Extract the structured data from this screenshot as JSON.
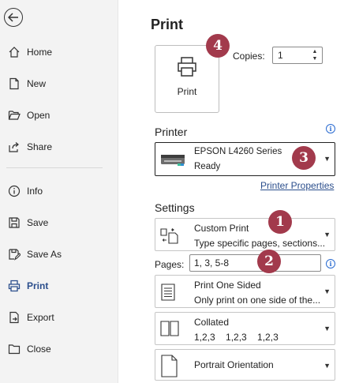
{
  "sidebar": {
    "items": [
      {
        "label": "Home",
        "icon": "home-icon"
      },
      {
        "label": "New",
        "icon": "new-document-icon"
      },
      {
        "label": "Open",
        "icon": "folder-open-icon"
      },
      {
        "label": "Share",
        "icon": "share-icon"
      },
      {
        "label": "Info",
        "icon": "info-icon"
      },
      {
        "label": "Save",
        "icon": "save-icon"
      },
      {
        "label": "Save As",
        "icon": "save-as-icon"
      },
      {
        "label": "Print",
        "icon": "printer-icon",
        "active": true
      },
      {
        "label": "Export",
        "icon": "export-icon"
      },
      {
        "label": "Close",
        "icon": "close-folder-icon"
      }
    ]
  },
  "main": {
    "title": "Print",
    "print_button_label": "Print",
    "copies_label": "Copies:",
    "copies_value": "1",
    "printer_heading": "Printer",
    "printer_name": "EPSON L4260 Series",
    "printer_status": "Ready",
    "printer_properties": "Printer Properties",
    "settings_heading": "Settings",
    "range": {
      "title": "Custom Print",
      "subtitle": "Type specific pages, sections..."
    },
    "pages_label": "Pages:",
    "pages_value": "1, 3, 5-8",
    "sides": {
      "title": "Print One Sided",
      "subtitle": "Only print on one side of the..."
    },
    "collation": {
      "title": "Collated",
      "subtitle": "1,2,3    1,2,3    1,2,3"
    },
    "orientation": {
      "title": "Portrait Orientation"
    }
  },
  "badges": [
    "1",
    "2",
    "3",
    "4"
  ],
  "colors": {
    "accent": "#2b4e8c",
    "badge": "#a23a4c",
    "info": "#2a6bd1"
  }
}
